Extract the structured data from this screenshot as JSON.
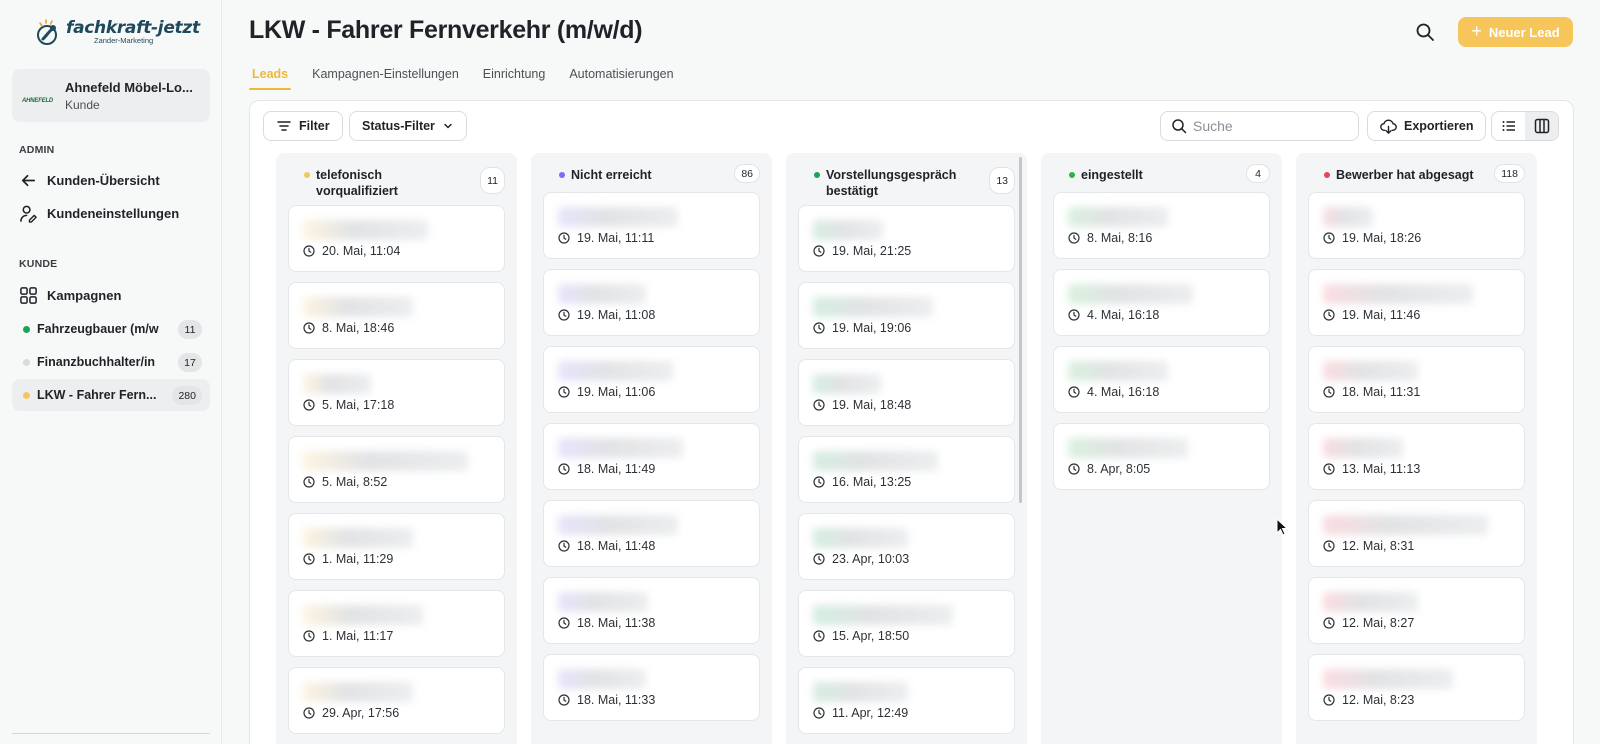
{
  "brand": {
    "name": "fachkraft-jetzt",
    "sub": "Zander-Marketing",
    "color": "#1f4a5e"
  },
  "client": {
    "logo_text": "AHNEFELD",
    "name": "Ahnefeld Möbel-Lo...",
    "role": "Kunde"
  },
  "sidebar": {
    "admin_label": "ADMIN",
    "admin_items": [
      {
        "label": "Kunden-Übersicht",
        "icon": "arrow-left-icon"
      },
      {
        "label": "Kundeneinstellungen",
        "icon": "user-settings-icon"
      }
    ],
    "kunde_label": "KUNDE",
    "campaigns_label": "Kampagnen",
    "campaigns": [
      {
        "label": "Fahrzeugbauer (m/w...",
        "count": "11",
        "color": "#1aa35a"
      },
      {
        "label": "Finanzbuchhalter/in ...",
        "count": "17",
        "color": "#d8dadd"
      },
      {
        "label": "LKW - Fahrer Fern...",
        "count": "280",
        "color": "#f6c65b"
      }
    ]
  },
  "header": {
    "title": "LKW - Fahrer Fernverkehr (m/w/d)",
    "new_lead_label": "Neuer Lead",
    "accent": "#f6c65b"
  },
  "tabs": [
    {
      "label": "Leads",
      "active": true
    },
    {
      "label": "Kampagnen-Einstellungen"
    },
    {
      "label": "Einrichtung"
    },
    {
      "label": "Automatisierungen"
    }
  ],
  "toolbar": {
    "filter_label": "Filter",
    "status_filter_label": "Status-Filter",
    "search_placeholder": "Suche",
    "export_label": "Exportieren"
  },
  "columns": [
    {
      "title": "telefonisch vorqualifiziert",
      "count": "11",
      "color": "#f6c65b",
      "cards": [
        "20. Mai, 11:04",
        "8. Mai, 18:46",
        "5. Mai, 17:18",
        "5. Mai, 8:52",
        "1. Mai, 11:29",
        "1. Mai, 11:17",
        "29. Apr, 17:56"
      ]
    },
    {
      "title": "Nicht erreicht",
      "count": "86",
      "color": "#7b6cf0",
      "cards": [
        "19. Mai, 11:11",
        "19. Mai, 11:08",
        "19. Mai, 11:06",
        "18. Mai, 11:49",
        "18. Mai, 11:48",
        "18. Mai, 11:38",
        "18. Mai, 11:33"
      ]
    },
    {
      "title": "Vorstellungsgespräch bestätigt",
      "count": "13",
      "color": "#1aa35a",
      "cards": [
        "19. Mai, 21:25",
        "19. Mai, 19:06",
        "19. Mai, 18:48",
        "16. Mai, 13:25",
        "23. Apr, 10:03",
        "15. Apr, 18:50",
        "11. Apr, 12:49"
      ]
    },
    {
      "title": "eingestellt",
      "count": "4",
      "color": "#2fb34a",
      "cards": [
        "8. Mai, 8:16",
        "4. Mai, 16:18",
        "4. Mai, 16:18",
        "8. Apr, 8:05"
      ]
    },
    {
      "title": "Bewerber hat abgesagt",
      "count": "118",
      "color": "#e8435a",
      "cards": [
        "19. Mai, 18:26",
        "19. Mai, 11:46",
        "18. Mai, 11:31",
        "13. Mai, 11:13",
        "12. Mai, 8:31",
        "12. Mai, 8:27",
        "12. Mai, 8:23"
      ]
    }
  ]
}
